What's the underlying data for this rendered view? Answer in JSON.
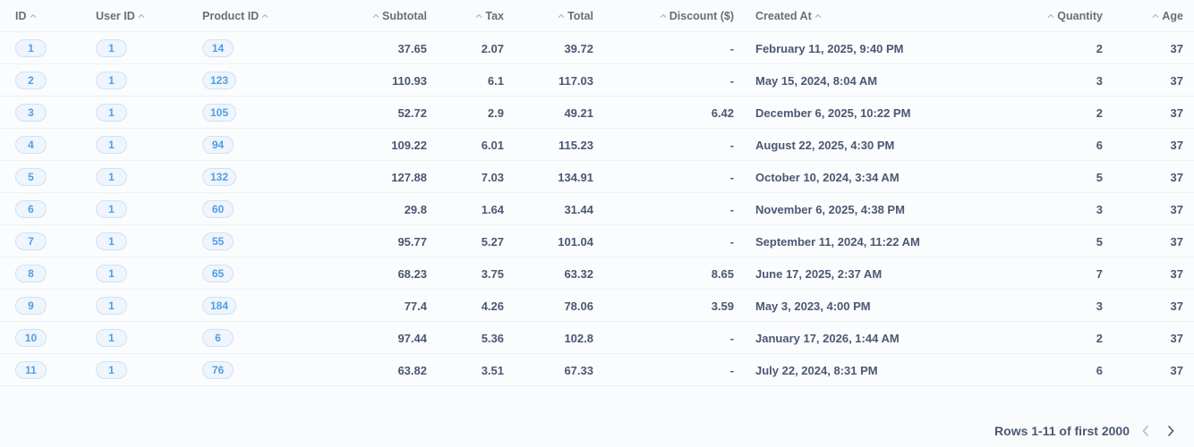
{
  "columns": [
    {
      "label": "ID"
    },
    {
      "label": "User ID"
    },
    {
      "label": "Product ID"
    },
    {
      "label": "Subtotal"
    },
    {
      "label": "Tax"
    },
    {
      "label": "Total"
    },
    {
      "label": "Discount ($)"
    },
    {
      "label": "Created At"
    },
    {
      "label": "Quantity"
    },
    {
      "label": "Age"
    }
  ],
  "rows": [
    {
      "id": "1",
      "user_id": "1",
      "product_id": "14",
      "subtotal": "37.65",
      "tax": "2.07",
      "total": "39.72",
      "discount": "-",
      "created_at": "February 11, 2025, 9:40 PM",
      "quantity": "2",
      "age": "37"
    },
    {
      "id": "2",
      "user_id": "1",
      "product_id": "123",
      "subtotal": "110.93",
      "tax": "6.1",
      "total": "117.03",
      "discount": "-",
      "created_at": "May 15, 2024, 8:04 AM",
      "quantity": "3",
      "age": "37"
    },
    {
      "id": "3",
      "user_id": "1",
      "product_id": "105",
      "subtotal": "52.72",
      "tax": "2.9",
      "total": "49.21",
      "discount": "6.42",
      "created_at": "December 6, 2025, 10:22 PM",
      "quantity": "2",
      "age": "37"
    },
    {
      "id": "4",
      "user_id": "1",
      "product_id": "94",
      "subtotal": "109.22",
      "tax": "6.01",
      "total": "115.23",
      "discount": "-",
      "created_at": "August 22, 2025, 4:30 PM",
      "quantity": "6",
      "age": "37"
    },
    {
      "id": "5",
      "user_id": "1",
      "product_id": "132",
      "subtotal": "127.88",
      "tax": "7.03",
      "total": "134.91",
      "discount": "-",
      "created_at": "October 10, 2024, 3:34 AM",
      "quantity": "5",
      "age": "37"
    },
    {
      "id": "6",
      "user_id": "1",
      "product_id": "60",
      "subtotal": "29.8",
      "tax": "1.64",
      "total": "31.44",
      "discount": "-",
      "created_at": "November 6, 2025, 4:38 PM",
      "quantity": "3",
      "age": "37"
    },
    {
      "id": "7",
      "user_id": "1",
      "product_id": "55",
      "subtotal": "95.77",
      "tax": "5.27",
      "total": "101.04",
      "discount": "-",
      "created_at": "September 11, 2024, 11:22 AM",
      "quantity": "5",
      "age": "37"
    },
    {
      "id": "8",
      "user_id": "1",
      "product_id": "65",
      "subtotal": "68.23",
      "tax": "3.75",
      "total": "63.32",
      "discount": "8.65",
      "created_at": "June 17, 2025, 2:37 AM",
      "quantity": "7",
      "age": "37"
    },
    {
      "id": "9",
      "user_id": "1",
      "product_id": "184",
      "subtotal": "77.4",
      "tax": "4.26",
      "total": "78.06",
      "discount": "3.59",
      "created_at": "May 3, 2023, 4:00 PM",
      "quantity": "3",
      "age": "37"
    },
    {
      "id": "10",
      "user_id": "1",
      "product_id": "6",
      "subtotal": "97.44",
      "tax": "5.36",
      "total": "102.8",
      "discount": "-",
      "created_at": "January 17, 2026, 1:44 AM",
      "quantity": "2",
      "age": "37"
    },
    {
      "id": "11",
      "user_id": "1",
      "product_id": "76",
      "subtotal": "63.82",
      "tax": "3.51",
      "total": "67.33",
      "discount": "-",
      "created_at": "July 22, 2024, 8:31 PM",
      "quantity": "6",
      "age": "37"
    }
  ],
  "footer": {
    "rows_text": "Rows 1-11 of first 2000"
  },
  "icons": {
    "sort": "chevron-up-icon",
    "prev": "chevron-left-icon",
    "next": "chevron-right-icon"
  },
  "colors": {
    "pill_text": "#509ee3",
    "pill_bg": "#eef5fc",
    "pill_border": "#cfe2f5",
    "text": "#4c5773"
  }
}
